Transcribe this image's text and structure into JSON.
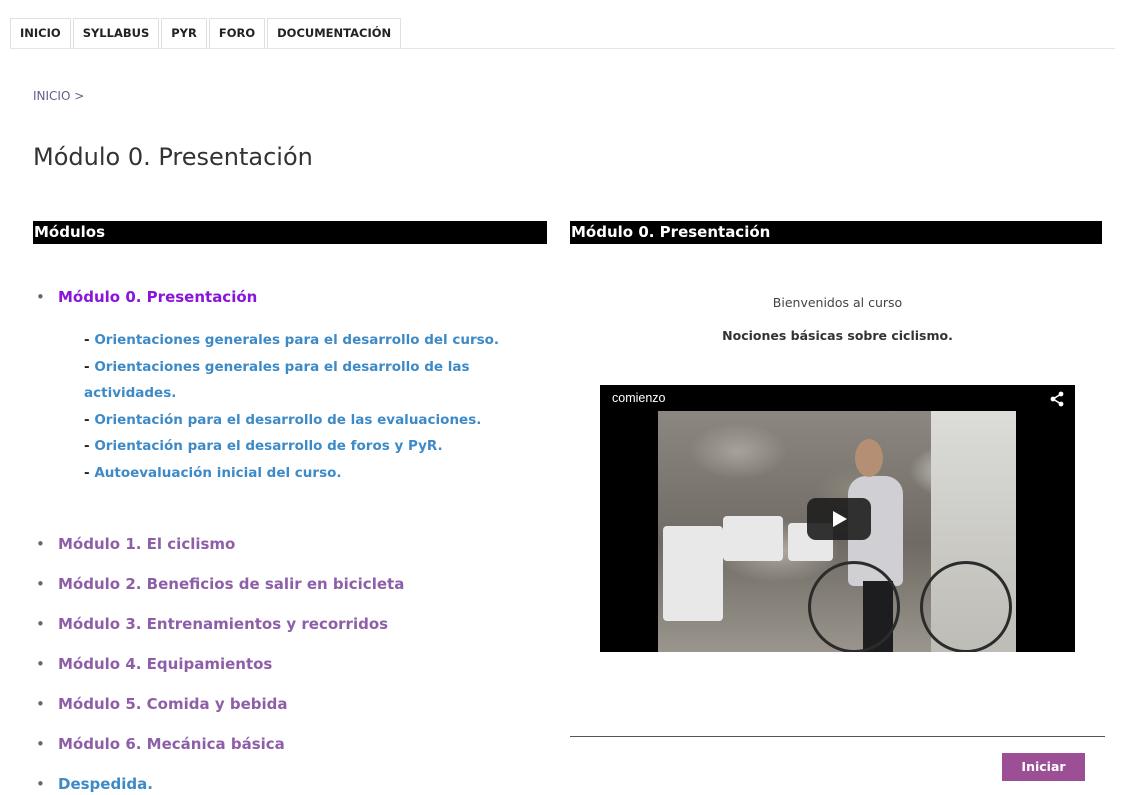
{
  "nav": {
    "tabs": [
      {
        "label": "INICIO"
      },
      {
        "label": "SYLLABUS"
      },
      {
        "label": "PYR"
      },
      {
        "label": "FORO"
      },
      {
        "label": "DOCUMENTACIÓN"
      }
    ]
  },
  "breadcrumb": "INICIO >",
  "page_title": "Módulo 0. Presentación",
  "left_panel": {
    "header": "Módulos",
    "active_module": "Módulo 0. Presentación",
    "subitems": [
      {
        "dash": "- ",
        "label": "Orientaciones generales para el desarrollo del curso."
      },
      {
        "dash": "- ",
        "label": "Orientaciones generales para el desarrollo de las actividades."
      },
      {
        "dash": "- ",
        "label": "Orientación para el desarrollo de las evaluaciones."
      },
      {
        "dash": "- ",
        "label": "Orientación para el desarrollo de foros y PyR."
      },
      {
        "dash": "- ",
        "label": "Autoevaluación inicial del curso."
      }
    ],
    "modules": [
      {
        "label": "Módulo 1. El ciclismo"
      },
      {
        "label": "Módulo 2. Beneficios de salir en bicicleta"
      },
      {
        "label": "Módulo 3. Entrenamientos y recorridos"
      },
      {
        "label": "Módulo 4. Equipamientos"
      },
      {
        "label": "Módulo 5. Comida y bebida"
      },
      {
        "label": "Módulo 6. Mecánica básica"
      }
    ],
    "farewell": "Despedida."
  },
  "right_panel": {
    "header": "Módulo 0. Presentación",
    "welcome": "Bienvenidos al curso",
    "subtitle": "Nociones básicas sobre ciclismo.",
    "video": {
      "title": "comienzo",
      "share_icon": "share-icon",
      "play_icon": "play-icon"
    },
    "start_button": "Iniciar"
  },
  "colors": {
    "module_link": "#8e5fa8",
    "active_module": "#8a14d9",
    "sublink": "#3d8ac7",
    "header_bar": "#000000",
    "button": "#9c4f95"
  }
}
